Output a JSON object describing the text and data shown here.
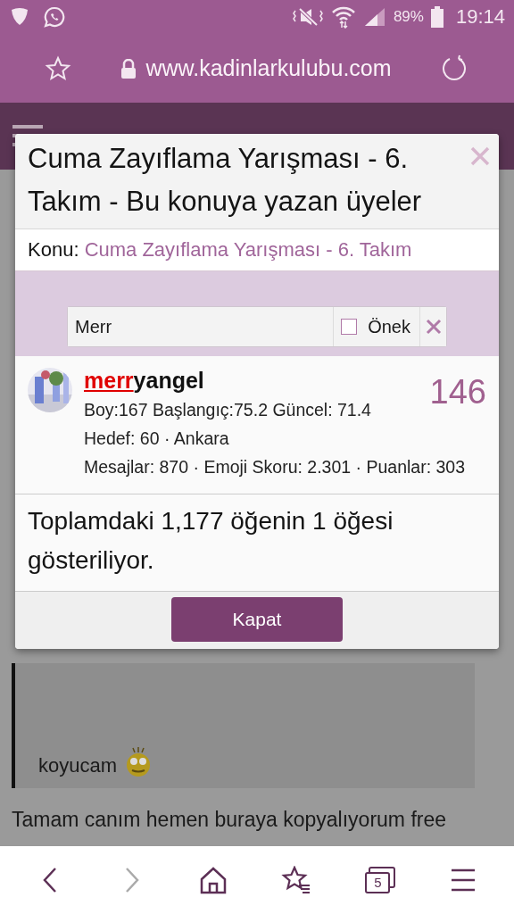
{
  "status_bar": {
    "battery": "89%",
    "time": "19:14"
  },
  "address_bar": {
    "url": "www.kadinlarkulubu.com"
  },
  "page": {
    "quote_text": "koyucam",
    "post_text": "Tamam canım hemen buraya kopyalıyorum free"
  },
  "dialog": {
    "title": "Cuma Zayıflama Yarışması - 6. Takım - Bu konuya yazan üyeler",
    "topic_label": "Konu:",
    "topic_link": "Cuma Zayıflama Yarışması - 6. Takım",
    "filter": {
      "value": "Merr",
      "prefix_label": "Önek",
      "prefix_checked": false
    },
    "members": [
      {
        "name_match": "merr",
        "name_rest": "yangel",
        "count": "146",
        "lines": [
          "Boy:167 Başlangıç:75.2 Güncel: 71.4",
          "Hedef: 60 · Ankara",
          "Mesajlar: 870 · Emoji Skoru: 2.301 · Puanlar: 303"
        ]
      }
    ],
    "summary": "Toplamdaki 1,177 öğenin 1 öğesi gösteriliyor.",
    "close_button": "Kapat"
  },
  "bottom_nav": {
    "tab_count": "5",
    "forward_disabled": true
  }
}
